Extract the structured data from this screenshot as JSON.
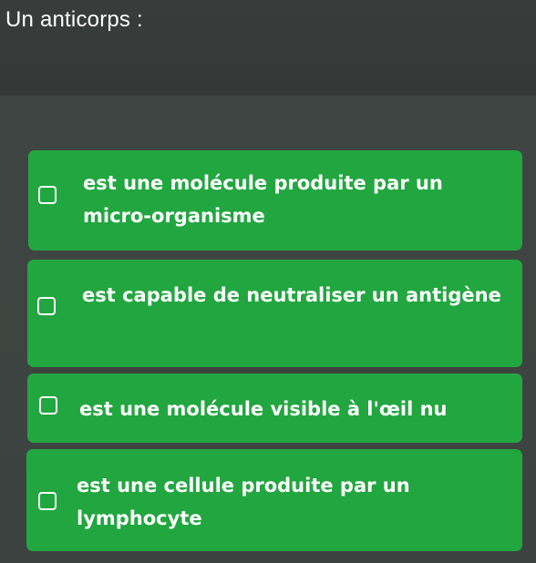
{
  "question": {
    "text": "Un anticorps :"
  },
  "options": [
    {
      "label": "est une molécule produite par un micro-organisme",
      "checked": false
    },
    {
      "label": "est capable de neutraliser un antigène",
      "checked": false
    },
    {
      "label": "est une molécule visible à l'œil nu",
      "checked": false
    },
    {
      "label": "est une cellule produite par un lymphocyte",
      "checked": false
    }
  ],
  "colors": {
    "option_background": "#22a640",
    "page_background": "#3d4340",
    "text": "#ffffff"
  }
}
